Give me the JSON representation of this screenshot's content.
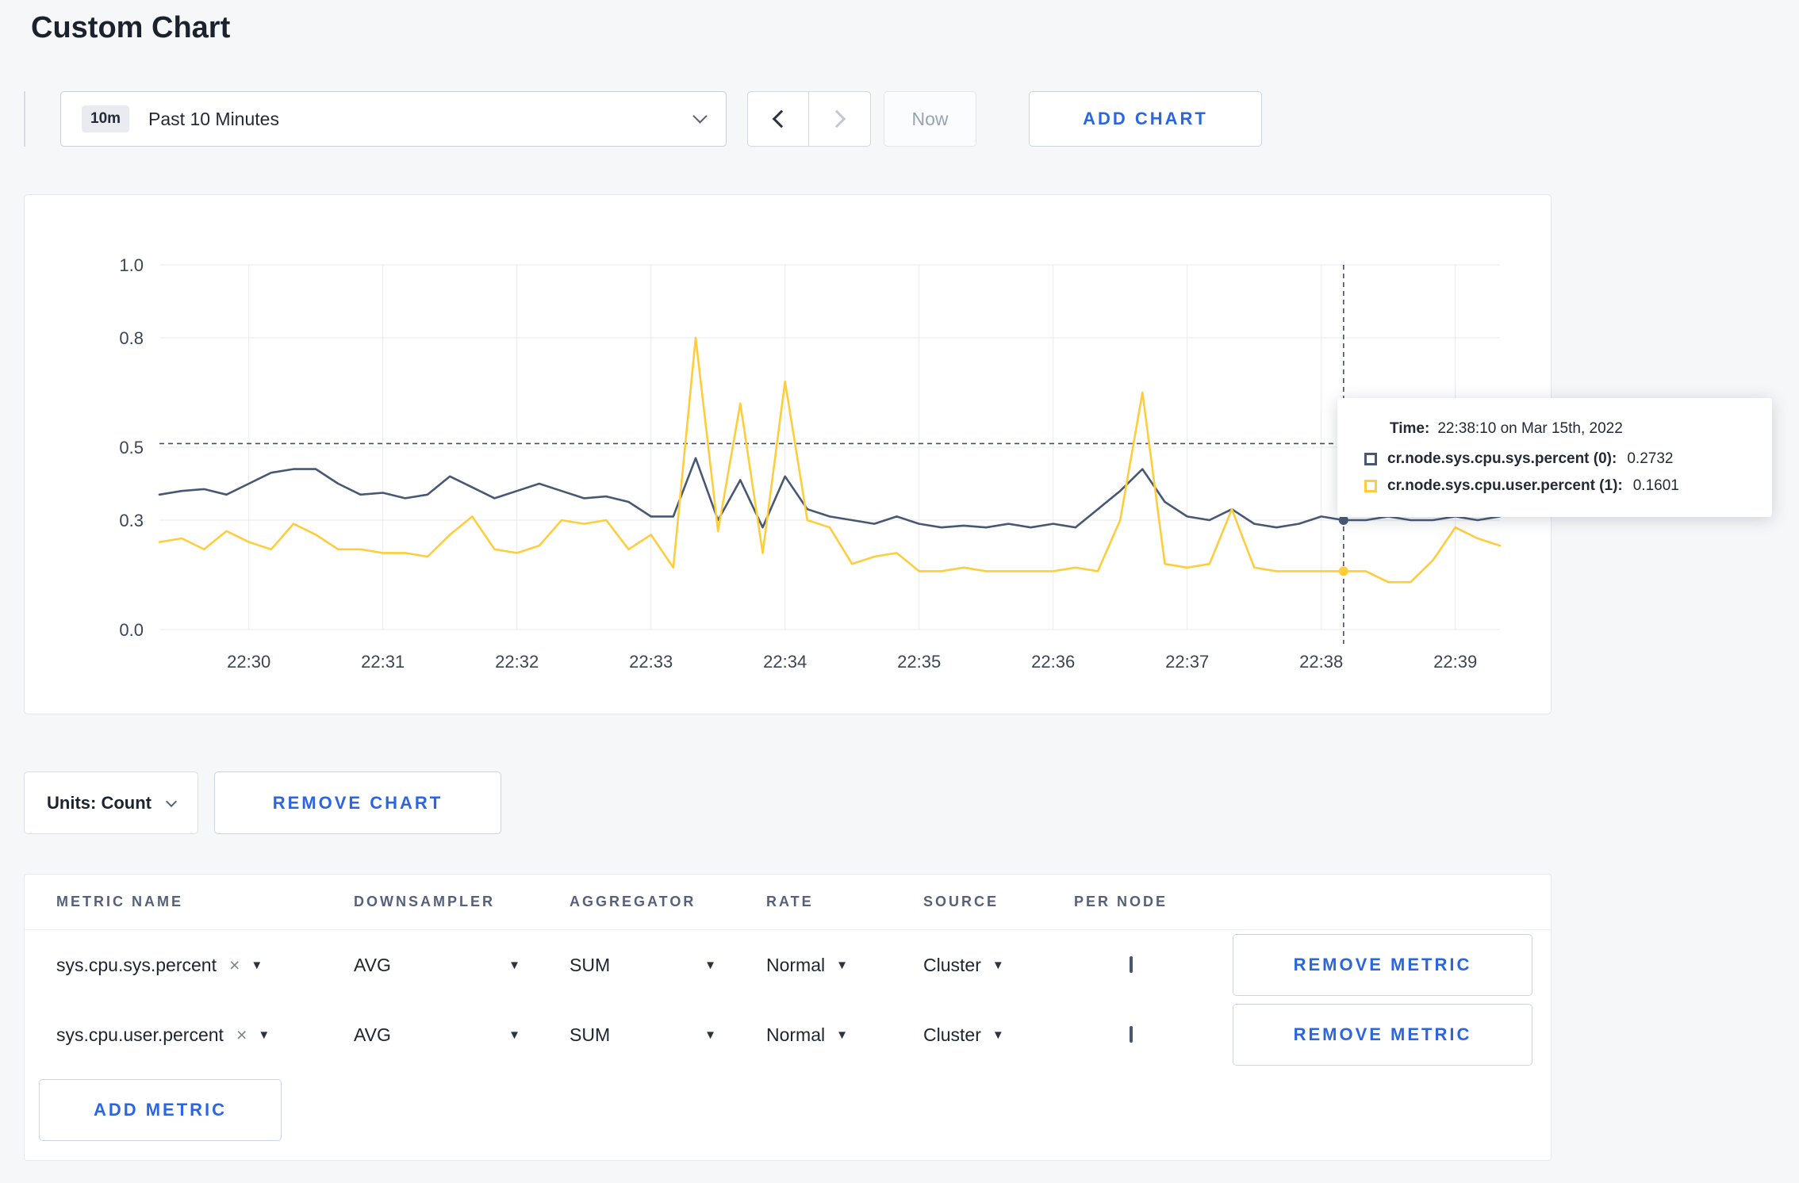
{
  "page": {
    "title": "Custom Chart"
  },
  "toolbar": {
    "time_range_badge": "10m",
    "time_range_label": "Past 10 Minutes",
    "now_label": "Now",
    "add_chart_label": "ADD CHART"
  },
  "chart_data": {
    "type": "line",
    "title": "",
    "xlabel": "",
    "ylabel": "",
    "ylim": [
      0,
      1
    ],
    "y_ticks": [
      0.0,
      0.3,
      0.5,
      0.8,
      1.0
    ],
    "x_ticks": [
      "22:30",
      "22:31",
      "22:32",
      "22:33",
      "22:34",
      "22:35",
      "22:36",
      "22:37",
      "22:38",
      "22:39"
    ],
    "x_tick_seconds": [
      40,
      100,
      160,
      220,
      280,
      340,
      400,
      460,
      520,
      580
    ],
    "sample_interval_seconds": 10,
    "grid": true,
    "legend_position": "tooltip",
    "series": [
      {
        "name": "cr.node.sys.cpu.sys.percent",
        "color": "#475872",
        "values": [
          0.37,
          0.38,
          0.385,
          0.37,
          0.4,
          0.43,
          0.44,
          0.44,
          0.4,
          0.37,
          0.375,
          0.36,
          0.37,
          0.42,
          0.39,
          0.36,
          0.38,
          0.4,
          0.38,
          0.36,
          0.365,
          0.35,
          0.31,
          0.31,
          0.47,
          0.3,
          0.41,
          0.28,
          0.42,
          0.33,
          0.31,
          0.3,
          0.29,
          0.31,
          0.29,
          0.28,
          0.285,
          0.28,
          0.29,
          0.28,
          0.29,
          0.28,
          0.33,
          0.38,
          0.44,
          0.35,
          0.31,
          0.3,
          0.33,
          0.29,
          0.28,
          0.29,
          0.31,
          0.3,
          0.3,
          0.31,
          0.3,
          0.3,
          0.31,
          0.3,
          0.31
        ]
      },
      {
        "name": "cr.node.sys.cpu.user.percent",
        "color": "#ffcd3c",
        "values": [
          0.24,
          0.25,
          0.22,
          0.27,
          0.24,
          0.22,
          0.29,
          0.26,
          0.22,
          0.22,
          0.21,
          0.21,
          0.2,
          0.26,
          0.31,
          0.22,
          0.21,
          0.23,
          0.3,
          0.29,
          0.3,
          0.22,
          0.26,
          0.17,
          0.8,
          0.27,
          0.62,
          0.21,
          0.68,
          0.3,
          0.28,
          0.18,
          0.2,
          0.21,
          0.16,
          0.16,
          0.17,
          0.16,
          0.16,
          0.16,
          0.16,
          0.17,
          0.16,
          0.3,
          0.65,
          0.18,
          0.17,
          0.18,
          0.33,
          0.17,
          0.16,
          0.16,
          0.16,
          0.16,
          0.16,
          0.13,
          0.13,
          0.19,
          0.28,
          0.25,
          0.23
        ]
      }
    ],
    "crosshair": {
      "t_seconds": 530,
      "guide_value": 0.51
    }
  },
  "tooltip": {
    "time_label": "Time:",
    "time_value": "22:38:10 on Mar 15th, 2022",
    "rows": [
      {
        "label": "cr.node.sys.cpu.sys.percent (0):",
        "value": "0.2732",
        "color": "#475872"
      },
      {
        "label": "cr.node.sys.cpu.user.percent (1):",
        "value": "0.1601",
        "color": "#ffcd3c"
      }
    ]
  },
  "chart_controls": {
    "units_label": "Units: Count",
    "remove_chart_label": "REMOVE CHART"
  },
  "metrics_table": {
    "headers": [
      "METRIC NAME",
      "DOWNSAMPLER",
      "AGGREGATOR",
      "RATE",
      "SOURCE",
      "PER NODE"
    ],
    "rows": [
      {
        "metric": "sys.cpu.sys.percent",
        "downsampler": "AVG",
        "aggregator": "SUM",
        "rate": "Normal",
        "source": "Cluster",
        "per_node_checked": false,
        "remove_label": "REMOVE METRIC"
      },
      {
        "metric": "sys.cpu.user.percent",
        "downsampler": "AVG",
        "aggregator": "SUM",
        "rate": "Normal",
        "source": "Cluster",
        "per_node_checked": false,
        "remove_label": "REMOVE METRIC"
      }
    ],
    "add_metric_label": "ADD METRIC"
  }
}
